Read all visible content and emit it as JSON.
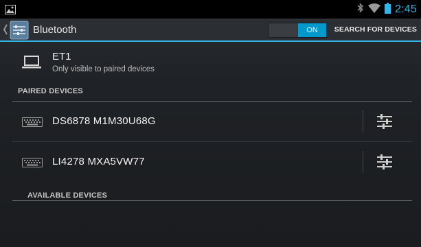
{
  "status_bar": {
    "time": "2:45",
    "icons": [
      "image-notification-icon",
      "bluetooth-icon",
      "wifi-icon",
      "battery-icon"
    ]
  },
  "action_bar": {
    "title": "Bluetooth",
    "toggle_label": "ON",
    "toggle_state": "on",
    "search_label": "SEARCH FOR DEVICES",
    "icons": [
      "up-caret-icon",
      "bluetooth-settings-app-icon"
    ]
  },
  "local_device": {
    "name": "ET1",
    "visibility": "Only visible to paired devices",
    "icon": "laptop-icon"
  },
  "paired_section": {
    "header": "PAIRED DEVICES",
    "devices": [
      {
        "name": "DS6878 M1M30U68G",
        "icon": "keyboard-icon",
        "action_icon": "sliders-settings-icon"
      },
      {
        "name": "LI4278 MXA5VW77",
        "icon": "keyboard-icon",
        "action_icon": "sliders-settings-icon"
      }
    ]
  },
  "available_section": {
    "header": "AVAILABLE DEVICES"
  },
  "colors": {
    "accent": "#33b5e5",
    "toggle_on": "#0099cc",
    "status_bar_bg": "#000000",
    "background": "#1f2226"
  }
}
